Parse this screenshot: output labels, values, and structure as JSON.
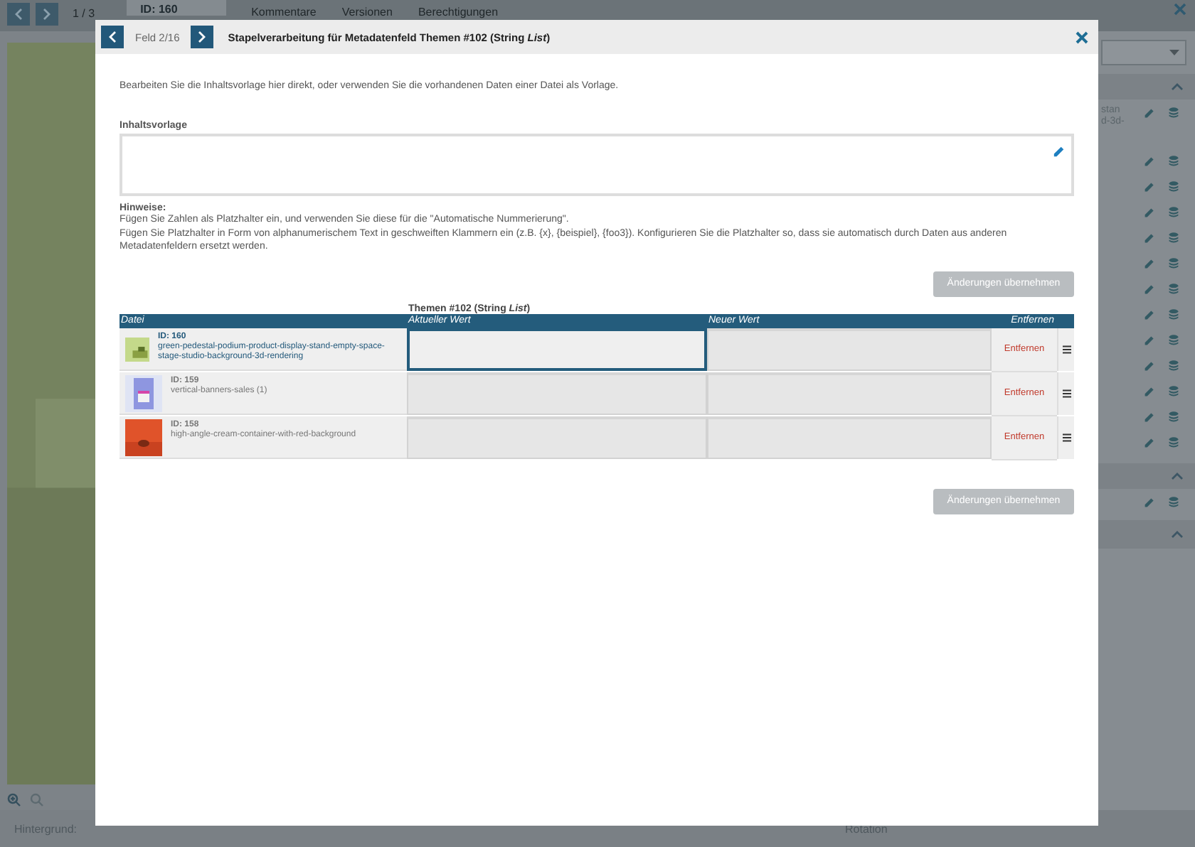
{
  "background": {
    "pager": "1 / 3",
    "id_tab": "ID: 160",
    "tabs": [
      {
        "label": "Kommentare"
      },
      {
        "label": "Versionen"
      },
      {
        "label": "Berechtigungen"
      }
    ],
    "panel_text": [
      "stan",
      "d-3d-"
    ],
    "hintergrund_label": "Hintergrund:",
    "rotation_label": "Rotation"
  },
  "dialog": {
    "counter": "Feld 2/16",
    "title": "Stapelverarbeitung für Metadatenfeld Themen #102 (String *List*)",
    "intro": "Bearbeiten Sie die Inhaltsvorlage hier direkt, oder verwenden Sie die vorhandenen Daten einer Datei als Vorlage.",
    "template": {
      "label": "Inhaltsvorlage"
    },
    "hints": {
      "heading": "Hinweise:",
      "lines": [
        "Fügen Sie Zahlen als Platzhalter ein, und verwenden Sie diese für die \"Automatische Nummerierung\".",
        "Fügen Sie Platzhalter in Form von alphanumerischem Text in geschweiften Klammern ein (z.B. {x}, {beispiel}, {foo3}). Konfigurieren Sie die Platzhalter so, dass sie automatisch durch Daten aus anderen Metadatenfeldern ersetzt werden."
      ]
    },
    "apply_buttons": [
      {
        "label": "Änderungen übernehmen",
        "disabled": true
      },
      {
        "label": "Änderungen übernehmen",
        "disabled": true
      }
    ],
    "table": {
      "group_heading": "Themen #102 (String *List*)",
      "columns": [
        "Datei",
        "Aktueller Wert",
        "Neuer Wert",
        "Entfernen"
      ],
      "rows": [
        {
          "id": "ID: 160",
          "name": "green-pedestal-podium-product-display-stand-empty-space-stage-studio-background-3d-rendering",
          "selected": true,
          "remove": "Entfernen"
        },
        {
          "id": "ID: 159",
          "name": "vertical-banners-sales (1)",
          "selected": false,
          "remove": "Entfernen"
        },
        {
          "id": "ID: 158",
          "name": "high-angle-cream-container-with-red-background",
          "selected": false,
          "remove": "Entfernen"
        }
      ]
    }
  }
}
